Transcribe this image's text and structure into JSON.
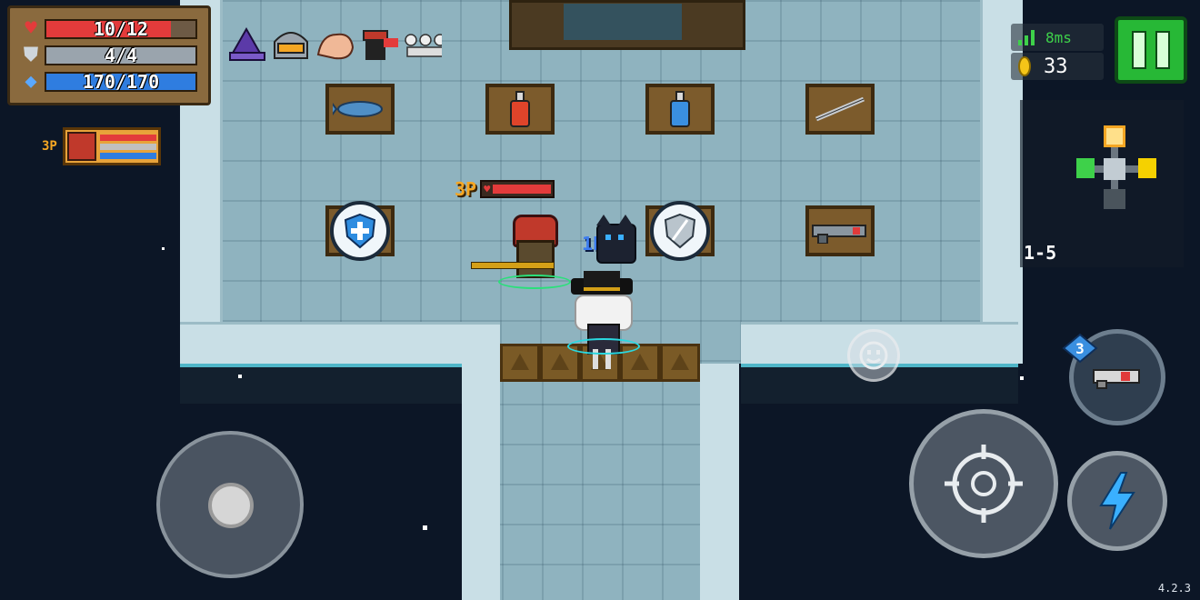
{
  "hud": {
    "hp": {
      "text": "10/12",
      "current": 10,
      "max": 12,
      "fill_fraction": 0.833,
      "color": "#e33b3b",
      "icon": "heart-icon"
    },
    "armor": {
      "text": "4/4",
      "current": 4,
      "max": 4,
      "fill_fraction": 1.0,
      "color": "#9aa4ad",
      "icon": "shield-icon"
    },
    "energy": {
      "text": "170/170",
      "current": 170,
      "max": 170,
      "fill_fraction": 1.0,
      "color": "#2f7de0",
      "icon": "diamond-icon"
    },
    "buffs": [
      "wizard-hat-buff-icon",
      "helmet-buff-icon",
      "muscle-arm-buff-icon",
      "bandit-buff-icon",
      "skeleton-squad-buff-icon"
    ],
    "teammate": {
      "tag": "3P",
      "hp_color": "#e33b3b",
      "armor_color": "#c0c0c0",
      "energy_color": "#2f7de0"
    },
    "ping": "8ms",
    "coins": "33",
    "level": "1-5",
    "energy_cost": "3",
    "version": "4.2.3"
  },
  "players": {
    "p3_tag": "3P",
    "p1_tag": "1P"
  },
  "shop_items": [
    "fish-weapon-icon",
    "red-potion-icon",
    "blue-potion-icon",
    "sword-icon",
    "armor-shield-orb-icon",
    "mirror-shield-orb-icon",
    "gun-weapon-icon"
  ],
  "colors": {
    "pause_green": "#27b836",
    "floor": "#8fb3bf",
    "ledge_glow": "#4fb6c8"
  }
}
